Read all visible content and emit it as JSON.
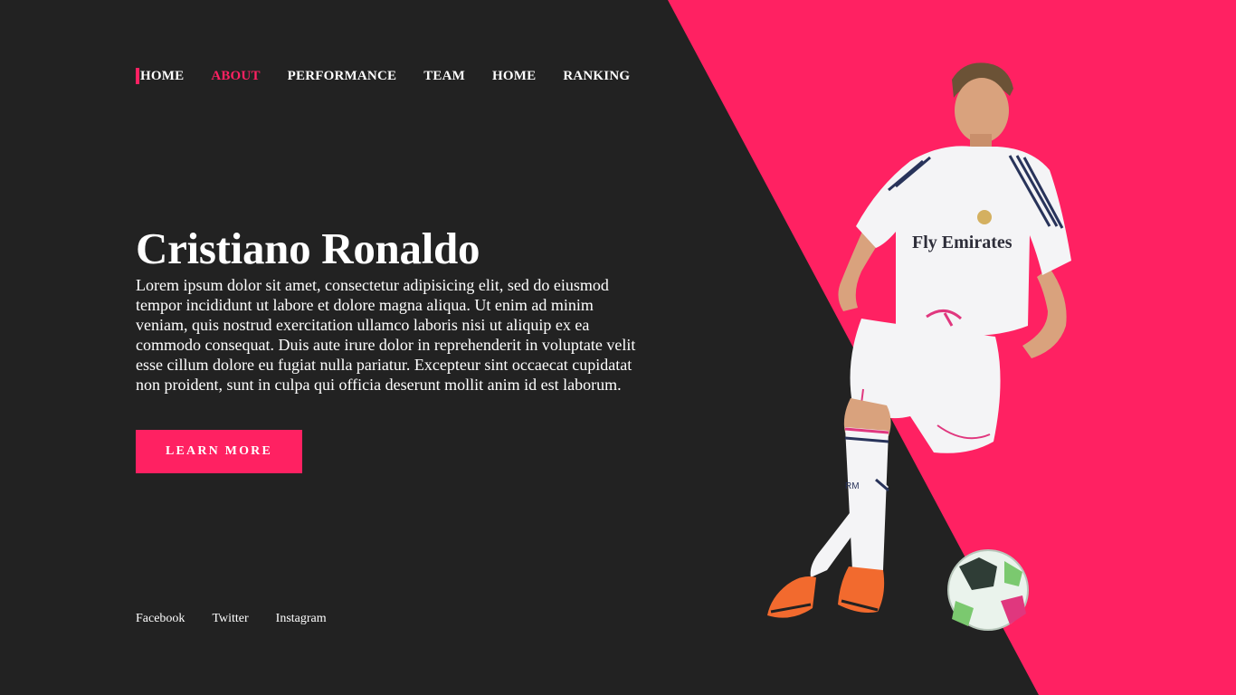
{
  "nav": {
    "items": [
      {
        "label": "HOME",
        "active": false
      },
      {
        "label": "ABOUT",
        "active": true
      },
      {
        "label": "PERFORMANCE",
        "active": false
      },
      {
        "label": "TEAM",
        "active": false
      },
      {
        "label": "HOME",
        "active": false
      },
      {
        "label": "RANKING",
        "active": false
      }
    ]
  },
  "hero": {
    "title": "Cristiano Ronaldo",
    "body": "Lorem ipsum dolor sit amet, consectetur adipisicing elit, sed do eiusmod tempor incididunt ut labore et dolore magna aliqua. Ut enim ad minim veniam, quis nostrud exercitation ullamco laboris nisi ut aliquip ex ea commodo consequat. Duis aute irure dolor in reprehenderit in voluptate velit esse cillum dolore eu fugiat nulla pariatur. Excepteur sint occaecat cupidatat non proident, sunt in culpa qui officia deserunt mollit anim id est laborum.",
    "cta_label": "LEARN MORE"
  },
  "social": {
    "links": [
      "Facebook",
      "Twitter",
      "Instagram"
    ]
  },
  "player_image": {
    "jersey_sponsor": "Fly Emirates",
    "sock_text": "RM"
  },
  "colors": {
    "background": "#222222",
    "accent": "#ff2162",
    "text": "#ffffff"
  }
}
